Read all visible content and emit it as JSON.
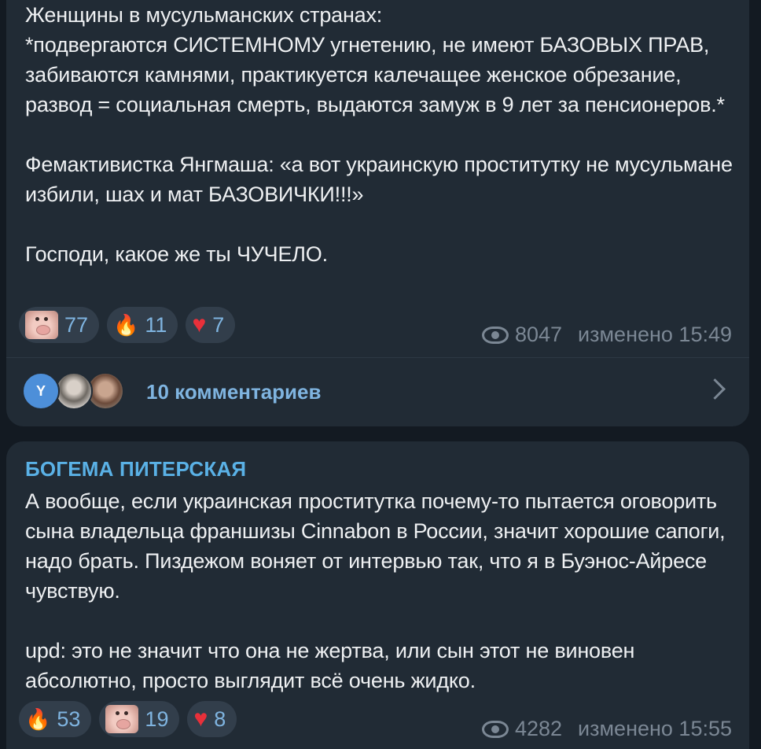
{
  "posts": [
    {
      "text": "Женщины в мусульманских странах:\n*подвергаются СИСТЕМНОМУ угнетению, не имеют БАЗОВЫХ ПРАВ, забиваются камнями, практикуется калечащее женское обрезание, развод = социальная смерть, выдаются замуж в 9 лет за пенсионеров.*\n\nФемактивистка Янгмаша: «а вот украинскую проститутку не мусульмане избили, шах и мат БАЗОВИЧКИ!!!»\n\nГосподи, какое же ты ЧУЧЕЛО.",
      "reactions": [
        {
          "icon": "pig-face-icon",
          "count": "77"
        },
        {
          "icon": "fire-icon",
          "count": "11"
        },
        {
          "icon": "heart-icon",
          "count": "7"
        }
      ],
      "views": "8047",
      "edited": "изменено 15:49",
      "comments": {
        "avatar_initial": "Y",
        "label": "10 комментариев"
      }
    },
    {
      "author": "БОГЕМА ПИТЕРСКАЯ",
      "text": "А вообще, если украинская проститутка почему-то пытается оговорить сына владельца франшизы Cinnabon в России, значит хорошие сапоги, надо брать. Пиздежом воняет от интервью так, что я в Буэнос-Айресе чувствую.\n\nupd: это не значит что она не жертва, или сын этот не виновен абсолютно, просто выглядит всё очень жидко.",
      "reactions": [
        {
          "icon": "fire-icon",
          "count": "53"
        },
        {
          "icon": "pig-face-icon",
          "count": "19"
        },
        {
          "icon": "heart-icon",
          "count": "8"
        }
      ],
      "views": "4282",
      "edited": "изменено 15:55"
    }
  ],
  "colors": {
    "background": "#131a22",
    "bubble": "#212b35",
    "accent": "#5ab1e6",
    "muted": "#7b8794"
  }
}
